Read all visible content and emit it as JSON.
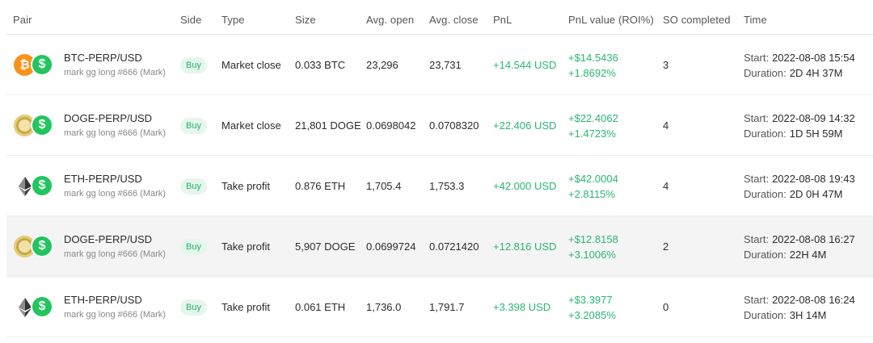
{
  "headers": {
    "pair": "Pair",
    "side": "Side",
    "type": "Type",
    "size": "Size",
    "avg_open": "Avg. open",
    "avg_close": "Avg. close",
    "pnl": "PnL",
    "pnl_value": "PnL value (ROI%)",
    "so_completed": "SO completed",
    "time": "Time"
  },
  "labels": {
    "start": "Start:",
    "duration": "Duration:"
  },
  "colors": {
    "positive": "#2ab673",
    "buy_badge_bg": "#e6f6ec",
    "quote_coin": "#22c55e",
    "btc": "#f7931a",
    "doge": "#c8a84a"
  },
  "rows": [
    {
      "base_icon": "bitcoin-icon",
      "quote_icon": "dollar-coin-icon",
      "pair": "BTC-PERP/USD",
      "bot": "mark gg long #666 (Mark)",
      "side": "Buy",
      "type": "Market close",
      "size": "0.033 BTC",
      "avg_open": "23,296",
      "avg_close": "23,731",
      "pnl": "+14.544 USD",
      "pnl_value": "+$14.5436",
      "roi": "+1.8692%",
      "so_completed": "3",
      "start": "2022-08-08 15:54",
      "duration": "2D 4H 37M"
    },
    {
      "base_icon": "dogecoin-icon",
      "quote_icon": "dollar-coin-icon",
      "pair": "DOGE-PERP/USD",
      "bot": "mark gg long #666 (Mark)",
      "side": "Buy",
      "type": "Market close",
      "size": "21,801 DOGE",
      "avg_open": "0.0698042",
      "avg_close": "0.0708320",
      "pnl": "+22.406 USD",
      "pnl_value": "+$22.4062",
      "roi": "+1.4723%",
      "so_completed": "4",
      "start": "2022-08-09 14:32",
      "duration": "1D 5H 59M"
    },
    {
      "base_icon": "ethereum-icon",
      "quote_icon": "dollar-coin-icon",
      "pair": "ETH-PERP/USD",
      "bot": "mark gg long #666 (Mark)",
      "side": "Buy",
      "type": "Take profit",
      "size": "0.876 ETH",
      "avg_open": "1,705.4",
      "avg_close": "1,753.3",
      "pnl": "+42.000 USD",
      "pnl_value": "+$42.0004",
      "roi": "+2.8115%",
      "so_completed": "4",
      "start": "2022-08-08 19:43",
      "duration": "2D 0H 47M"
    },
    {
      "base_icon": "dogecoin-icon",
      "quote_icon": "dollar-coin-icon",
      "pair": "DOGE-PERP/USD",
      "bot": "mark gg long #666 (Mark)",
      "side": "Buy",
      "type": "Take profit",
      "size": "5,907 DOGE",
      "avg_open": "0.0699724",
      "avg_close": "0.0721420",
      "pnl": "+12.816 USD",
      "pnl_value": "+$12.8158",
      "roi": "+3.1006%",
      "so_completed": "2",
      "start": "2022-08-08 16:27",
      "duration": "22H 4M"
    },
    {
      "base_icon": "ethereum-icon",
      "quote_icon": "dollar-coin-icon",
      "pair": "ETH-PERP/USD",
      "bot": "mark gg long #666 (Mark)",
      "side": "Buy",
      "type": "Take profit",
      "size": "0.061 ETH",
      "avg_open": "1,736.0",
      "avg_close": "1,791.7",
      "pnl": "+3.398 USD",
      "pnl_value": "+$3.3977",
      "roi": "+3.2085%",
      "so_completed": "0",
      "start": "2022-08-08 16:24",
      "duration": "3H 14M"
    }
  ]
}
